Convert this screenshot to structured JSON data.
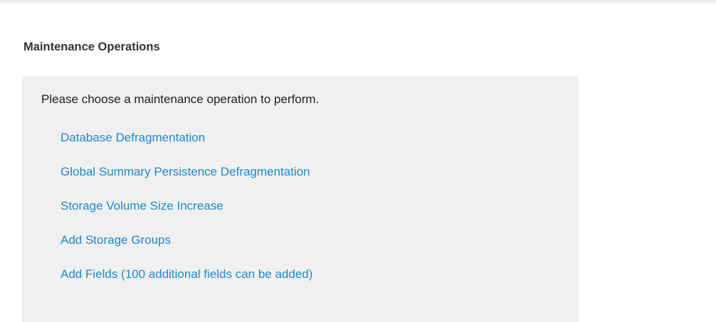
{
  "section": {
    "title": "Maintenance Operations"
  },
  "panel": {
    "prompt": "Please choose a maintenance operation to perform.",
    "operations": [
      {
        "label": "Database Defragmentation"
      },
      {
        "label": "Global Summary Persistence Defragmentation"
      },
      {
        "label": "Storage Volume Size Increase"
      },
      {
        "label": "Add Storage Groups"
      },
      {
        "label": "Add Fields (100 additional fields can be added)"
      }
    ]
  },
  "colors": {
    "link": "#1d8ac9",
    "panel_background": "#f0f0f0",
    "title_text": "#333333"
  }
}
